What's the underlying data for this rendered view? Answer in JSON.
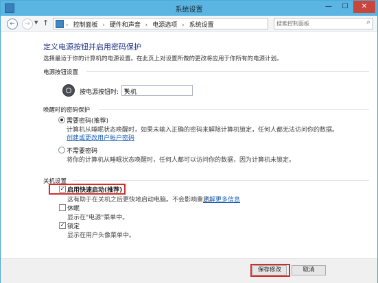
{
  "window": {
    "title": "系统设置",
    "min": "—",
    "max": "☐",
    "close": "✕"
  },
  "nav": {
    "back": "←",
    "forward": "→",
    "up": "↑",
    "breadcrumbs": [
      "控制面板",
      "硬件和声音",
      "电源选项",
      "系统设置"
    ],
    "separator": "›",
    "refresh": "↻",
    "search_placeholder": "搜索控制面板"
  },
  "page": {
    "title": "定义电源按钮并启用密码保护",
    "subtitle": "选择最适于你的计算机的电源设置。在此页上对设置所做的更改将应用于你所有的电源计划。"
  },
  "power_button": {
    "section": "电源按钮设置",
    "label": "按电源按钮时:",
    "selected": "关机"
  },
  "password": {
    "section": "唤醒时的密码保护",
    "require": {
      "label": "需要密码(推荐)",
      "desc": "计算机从睡眠状态唤醒时，如果未输入正确的密码来解除计算机锁定，任何人都无法访问你的数据。",
      "link": "创建或更改用户帐户密码",
      "selected": true
    },
    "no_require": {
      "label": "不需要密码",
      "desc": "将你的计算机从睡眠状态唤醒时，任何人都可以访问你的数据，因为计算机未锁定。",
      "selected": false
    }
  },
  "shutdown": {
    "section": "关机设置",
    "fast_startup": {
      "label": "启用快速启动(推荐)",
      "desc": "这有助于在关机之后更快地启动电脑。不会影响重启。",
      "link": "了解更多信息",
      "checked": true
    },
    "hibernate": {
      "label": "休眠",
      "desc": "显示在\"电源\"菜单中。",
      "checked": false
    },
    "lock": {
      "label": "锁定",
      "desc": "显示在用户头像菜单中。",
      "checked": true
    }
  },
  "footer": {
    "save": "保存修改",
    "cancel": "取消"
  },
  "colors": {
    "accent": "#1e3287",
    "link": "#1a5fb4",
    "highlight": "#d62b2b",
    "titlebar": "#5ab5e2"
  }
}
